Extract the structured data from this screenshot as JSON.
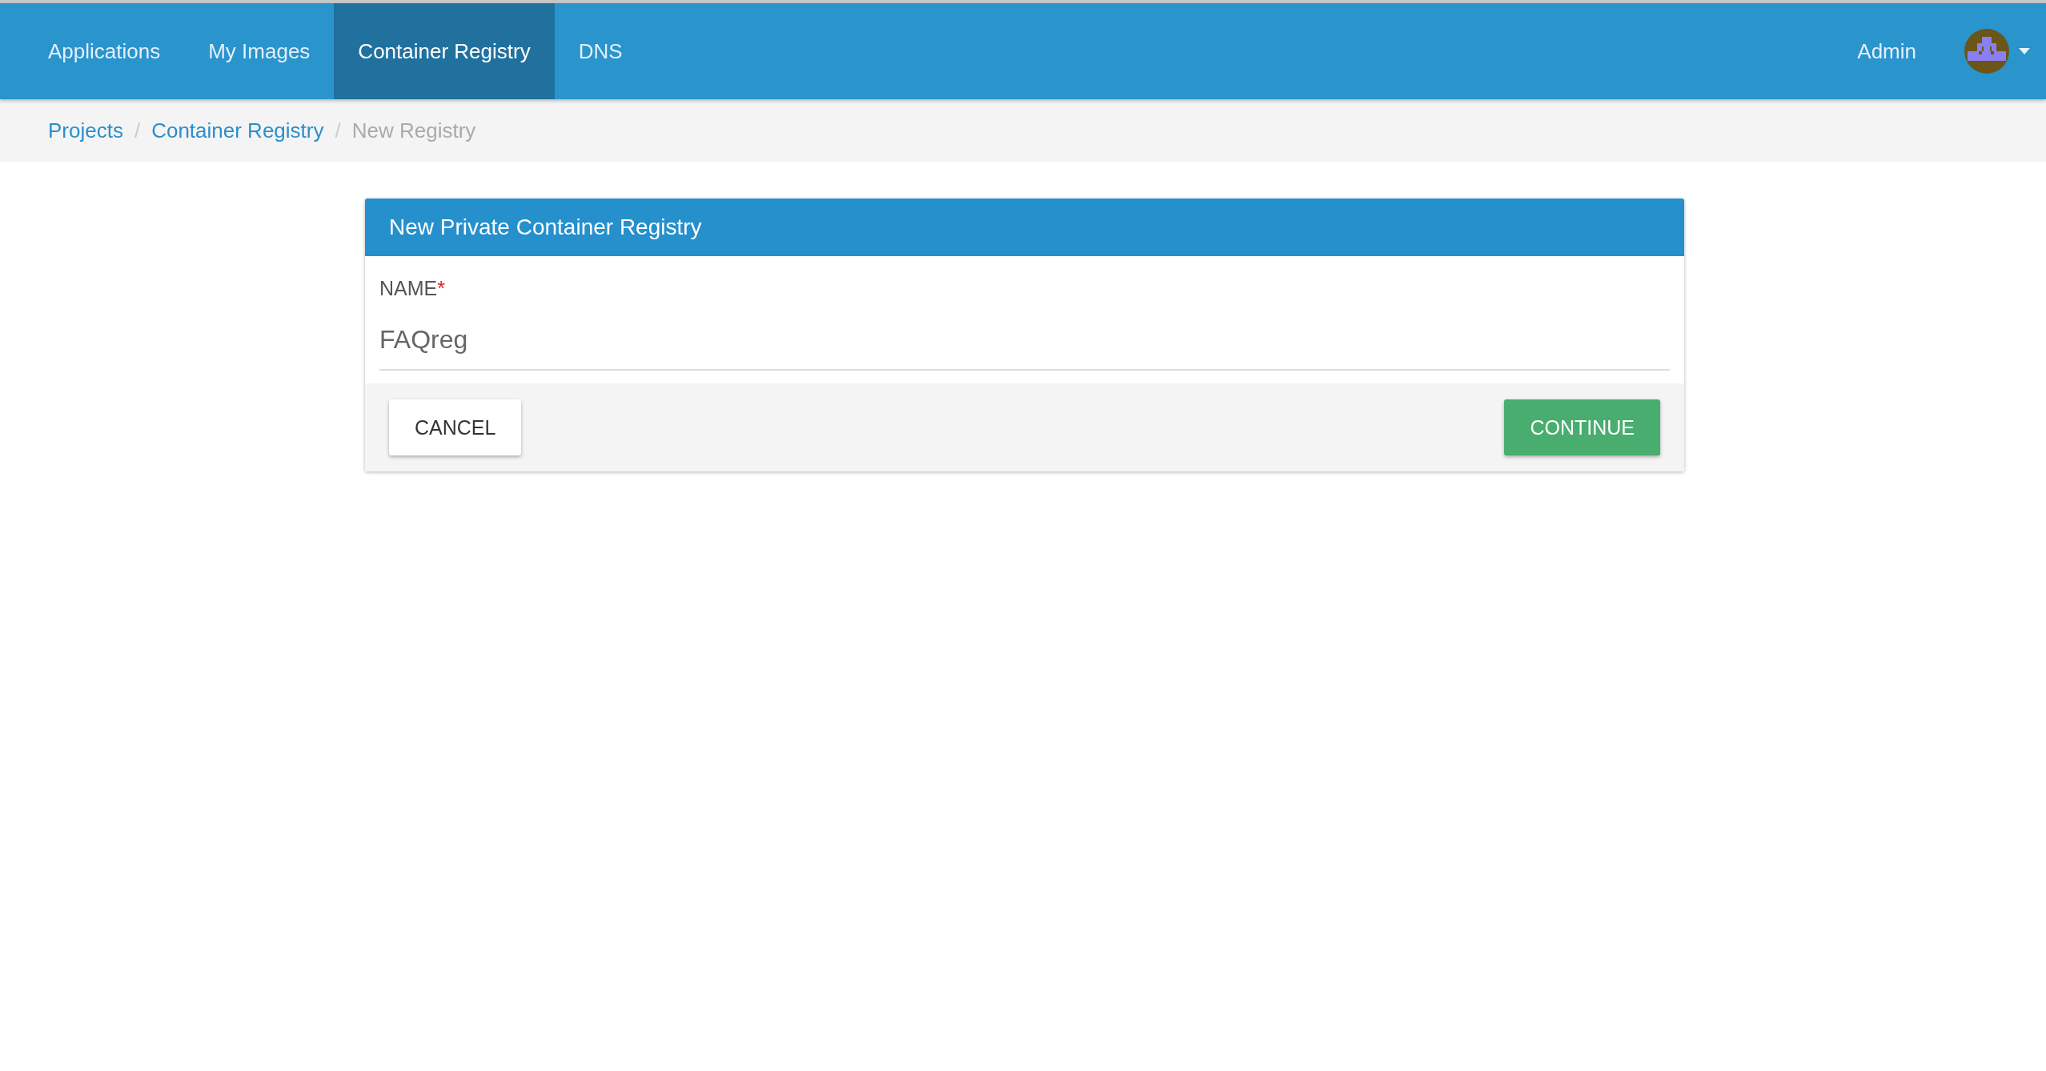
{
  "nav": {
    "tabs": [
      {
        "label": "Applications",
        "selected": false
      },
      {
        "label": "My Images",
        "selected": false
      },
      {
        "label": "Container Registry",
        "selected": true
      },
      {
        "label": "DNS",
        "selected": false
      }
    ],
    "user": "Admin"
  },
  "breadcrumb": [
    {
      "label": "Projects",
      "link": true
    },
    {
      "label": "Container Registry",
      "link": true,
      "separator": "/"
    },
    {
      "label": "New Registry",
      "link": false,
      "separator": "/"
    }
  ],
  "dialog": {
    "title": "New Private Container Registry",
    "field": {
      "label": "NAME",
      "required_mark": "*",
      "value": "FAQreg"
    },
    "buttons": [
      {
        "label": "CANCEL",
        "kind": "secondary"
      },
      {
        "label": "CONTINUE",
        "kind": "primary"
      }
    ]
  }
}
